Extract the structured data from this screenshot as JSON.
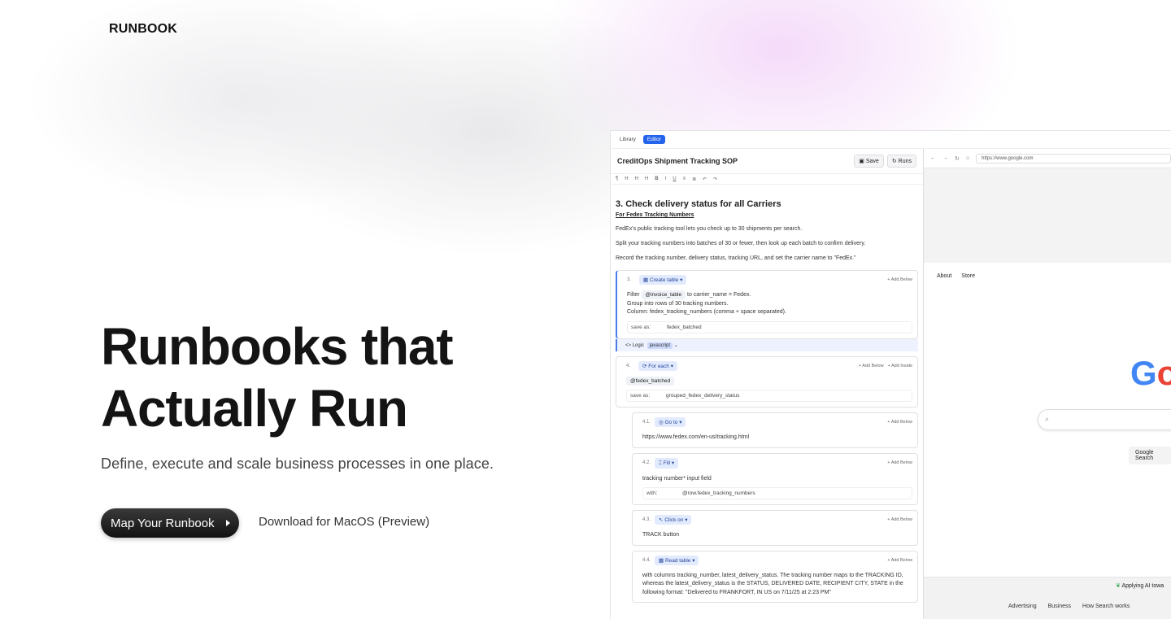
{
  "brand": "RUNBOOK",
  "hero": {
    "title_line1": "Runbooks that",
    "title_line2": "Actually Run",
    "subtitle": "Define, execute and scale business processes in one place.",
    "cta_primary": "Map Your Runbook",
    "cta_secondary": "Download for MacOS (Preview)"
  },
  "app": {
    "tabs": [
      "Library",
      "Editor"
    ],
    "doc_title": "CreditOps Shipment Tracking SOP",
    "save_label": "Save",
    "runs_label": "Runs",
    "section_title": "3. Check delivery status for all Carriers",
    "subheading": "For Fedex Tracking Numbers",
    "paragraphs": [
      "FedEx's public tracking tool lets you check up to 30 shipments per search.",
      "Split your tracking numbers into batches of 30 or fewer, then look up each batch to confirm delivery.",
      "Record the tracking number, delivery status, tracking URL, and set the carrier name to \"FedEx.\""
    ],
    "steps": {
      "s3": {
        "num": "3.",
        "action": "Create table",
        "add_below": "+ Add Below",
        "body_filter": "Filter",
        "body_var": "@invoice_table",
        "body_filter_rest": "to carrier_name = Fedex.",
        "body2": "Group into rows of 30 tracking numbers.",
        "body3": "Column: fedex_tracking_numbers (comma + space separated).",
        "save_as_label": "save as:",
        "save_as_value": "fedex_batched"
      },
      "logic": {
        "label": "Logic",
        "value": "javascript"
      },
      "s4": {
        "num": "4.",
        "action": "For each",
        "add_below": "+ Add Below",
        "add_inside": "+ Add Inside",
        "var": "@fedex_batched",
        "save_as_label": "save as:",
        "save_as_value": "grouped_fedex_delivery_status"
      },
      "s41": {
        "num": "4.1.",
        "action": "Go to",
        "add_below": "+ Add Below",
        "body": "https://www.fedex.com/en-us/tracking.html"
      },
      "s42": {
        "num": "4.2.",
        "action": "Fill",
        "add_below": "+ Add Below",
        "body": "tracking number* input field",
        "with_label": "with:",
        "with_value": "@row.fedex_tracking_numbers"
      },
      "s43": {
        "num": "4.3.",
        "action": "Click on",
        "add_below": "+ Add Below",
        "body": "TRACK button"
      },
      "s44": {
        "num": "4.4.",
        "action": "Read table",
        "add_below": "+ Add Below",
        "body": "with columns tracking_number, latest_delivery_status. The tracking number maps to the TRACKING ID, whereas the latest_delivery_status is the STATUS, DELIVERED DATE, RECIPIENT CITY, STATE in the following format: \"Delivered to FRANKFORT, IN US on 7/11/25 at 2:23 PM\""
      }
    }
  },
  "browser": {
    "url": "https://www.google.com",
    "nav": [
      "About",
      "Store"
    ],
    "logo_g": "G",
    "logo_o": "o",
    "search_button": "Google Search",
    "applying": "Applying AI towa",
    "footer_links": [
      "Advertising",
      "Business",
      "How Search works"
    ],
    "colors": {
      "g_blue": "#4285F4",
      "o_red": "#EA4335"
    }
  }
}
